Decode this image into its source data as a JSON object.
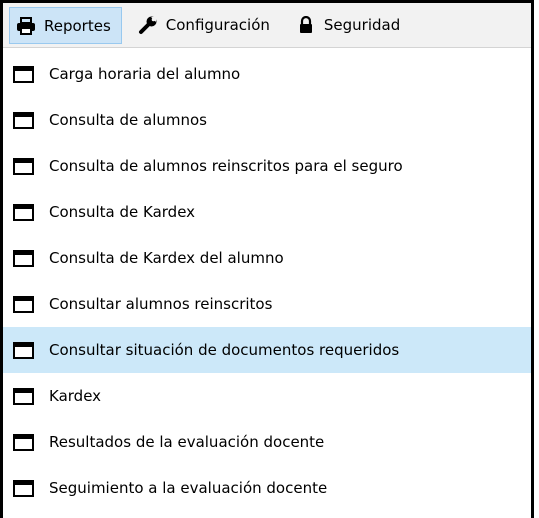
{
  "menubar": {
    "tabs": [
      {
        "label": "Reportes",
        "icon": "printer-icon",
        "active": true
      },
      {
        "label": "Configuración",
        "icon": "wrench-icon",
        "active": false
      },
      {
        "label": "Seguridad",
        "icon": "lock-icon",
        "active": false
      }
    ]
  },
  "menu": {
    "item_icon": "window-icon",
    "selected_color": "#cce8f9",
    "items": [
      {
        "label": "Carga horaria del alumno"
      },
      {
        "label": "Consulta de alumnos"
      },
      {
        "label": "Consulta de alumnos reinscritos para el seguro"
      },
      {
        "label": "Consulta de Kardex"
      },
      {
        "label": "Consulta de Kardex del alumno"
      },
      {
        "label": "Consultar alumnos reinscritos"
      },
      {
        "label": "Consultar situación de documentos requeridos",
        "selected": true
      },
      {
        "label": "Kardex"
      },
      {
        "label": "Resultados de la evaluación docente"
      },
      {
        "label": "Seguimiento a la evaluación docente"
      }
    ]
  }
}
